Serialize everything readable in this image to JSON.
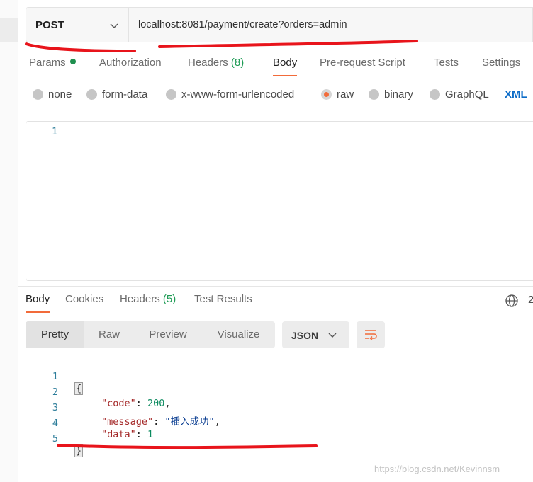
{
  "request": {
    "method": "POST",
    "url": "localhost:8081/payment/create?orders=admin"
  },
  "request_tabs": {
    "params": "Params",
    "authorization": "Authorization",
    "headers": "Headers",
    "headers_count": "(8)",
    "body": "Body",
    "prerequest": "Pre-request Script",
    "tests": "Tests",
    "settings": "Settings",
    "active": "Body"
  },
  "body_types": {
    "none": "none",
    "form_data": "form-data",
    "urlencoded": "x-www-form-urlencoded",
    "raw": "raw",
    "binary": "binary",
    "graphql": "GraphQL",
    "selected": "raw",
    "format": "XML"
  },
  "editor": {
    "line_numbers": [
      "1"
    ]
  },
  "response_tabs": {
    "body": "Body",
    "cookies": "Cookies",
    "headers": "Headers",
    "headers_count": "(5)",
    "test_results": "Test Results",
    "active": "Body",
    "status_fragment": "2"
  },
  "response_view": {
    "pretty": "Pretty",
    "raw": "Raw",
    "preview": "Preview",
    "visualize": "Visualize",
    "active": "Pretty",
    "language": "JSON"
  },
  "response_body": {
    "lines": [
      {
        "n": "1",
        "open": "{"
      },
      {
        "n": "2",
        "key": "\"code\"",
        "sep": ": ",
        "value": "200",
        "tail": ","
      },
      {
        "n": "3",
        "key": "\"message\"",
        "sep": ": ",
        "value": "\"插入成功\"",
        "tail": ","
      },
      {
        "n": "4",
        "key": "\"data\"",
        "sep": ": ",
        "value": "1",
        "tail": ""
      },
      {
        "n": "5",
        "close": "}"
      }
    ]
  },
  "watermark": "https://blog.csdn.net/Kevinnsm",
  "colors": {
    "accent": "#f26b3a",
    "count_green": "#1e9b55",
    "annotation_red": "#e8141b",
    "format_blue": "#0b6bc7"
  }
}
